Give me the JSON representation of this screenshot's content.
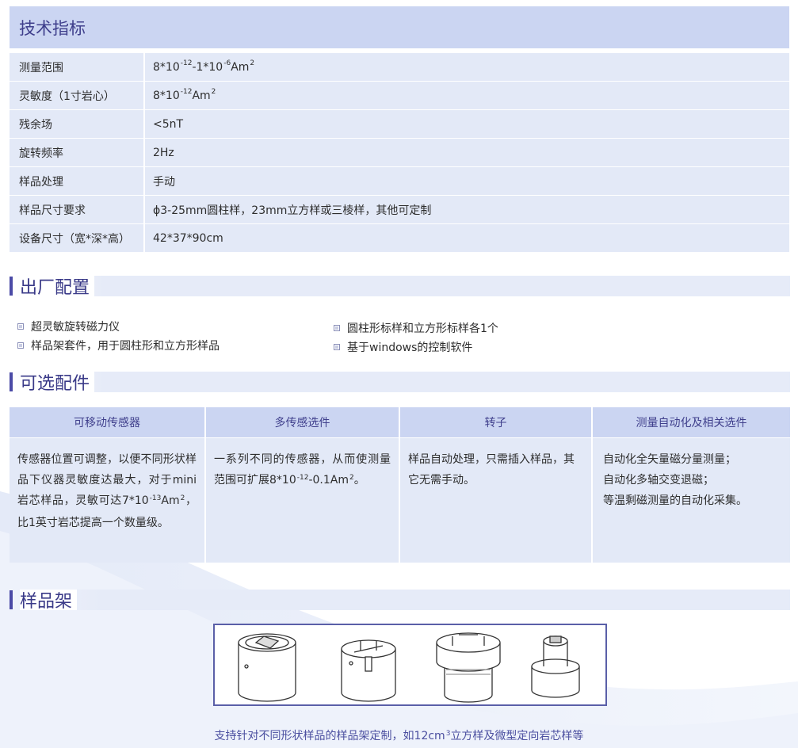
{
  "spec": {
    "title": "技术指标",
    "rows": [
      {
        "label": "测量范围",
        "value_parts": [
          "8*10",
          "-12",
          "-1*10",
          "-6",
          "Am",
          "2"
        ]
      },
      {
        "label": "灵敏度（1寸岩心）",
        "value_parts": [
          "8*10",
          "-12",
          "Am",
          "2"
        ]
      },
      {
        "label": "残余场",
        "value": "<5nT"
      },
      {
        "label": "旋转频率",
        "value": "2Hz"
      },
      {
        "label": "样品处理",
        "value": "手动"
      },
      {
        "label": "样品尺寸要求",
        "value": "ϕ3-25mm圆柱样，23mm立方样或三棱样，其他可定制"
      },
      {
        "label": "设备尺寸（宽*深*高）",
        "value": "42*37*90cm"
      }
    ]
  },
  "factory": {
    "title": "出厂配置",
    "items": [
      "超灵敏旋转磁力仪",
      "样品架套件，用于圆柱形和立方形样品",
      "圆柱形标样和立方形标样各1个",
      "基于windows的控制软件"
    ]
  },
  "options": {
    "title": "可选配件",
    "columns": [
      {
        "header": "可移动传感器",
        "body_parts": [
          "传感器位置可调整，以便不同形状样品下仪器灵敏度达最大，对于mini岩芯样品，灵敏可达7*10",
          "-13",
          "Am",
          "2",
          "，比1英寸岩芯提高一个数量级。"
        ]
      },
      {
        "header": "多传感选件",
        "body_parts": [
          "一系列不同的传感器，从而使测量范围可扩展8*10",
          "-12",
          "-0.1Am",
          "2",
          "。"
        ]
      },
      {
        "header": "转子",
        "body_parts": [
          "样品自动处理，只需插入样品，其它无需手动。"
        ]
      },
      {
        "header": "测量自动化及相关选件",
        "body_lines": [
          "自动化全矢量磁分量测量；",
          "自动化多轴交变退磁；",
          "等温剩磁测量的自动化采集。"
        ]
      }
    ]
  },
  "holder": {
    "title": "样品架",
    "caption_parts": [
      "支持针对不同形状样品的样品架定制，如12cm",
      "3",
      "立方样及微型定向岩芯样等"
    ]
  },
  "colors": {
    "accent": "#3f3f8c",
    "header_bg": "#cbd5f2",
    "row_bg": "#e3e9f7",
    "bar": "#4a4aa6"
  }
}
